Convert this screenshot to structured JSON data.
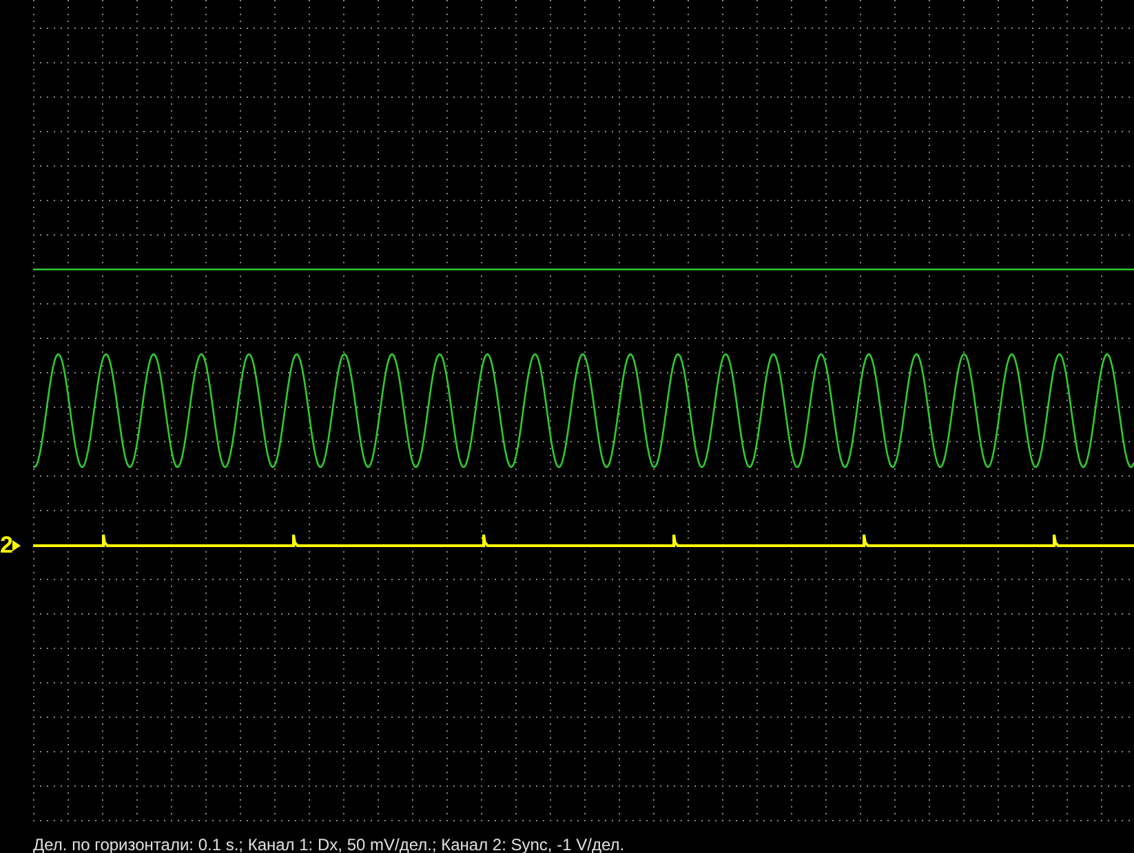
{
  "channel_marker": {
    "label": "2"
  },
  "status_bar": {
    "text": "Дел. по горизонтали: 0.1 s.; Канал 1: Dx, 50 mV/дел.; Канал 2: Sync, -1 V/дел."
  }
}
